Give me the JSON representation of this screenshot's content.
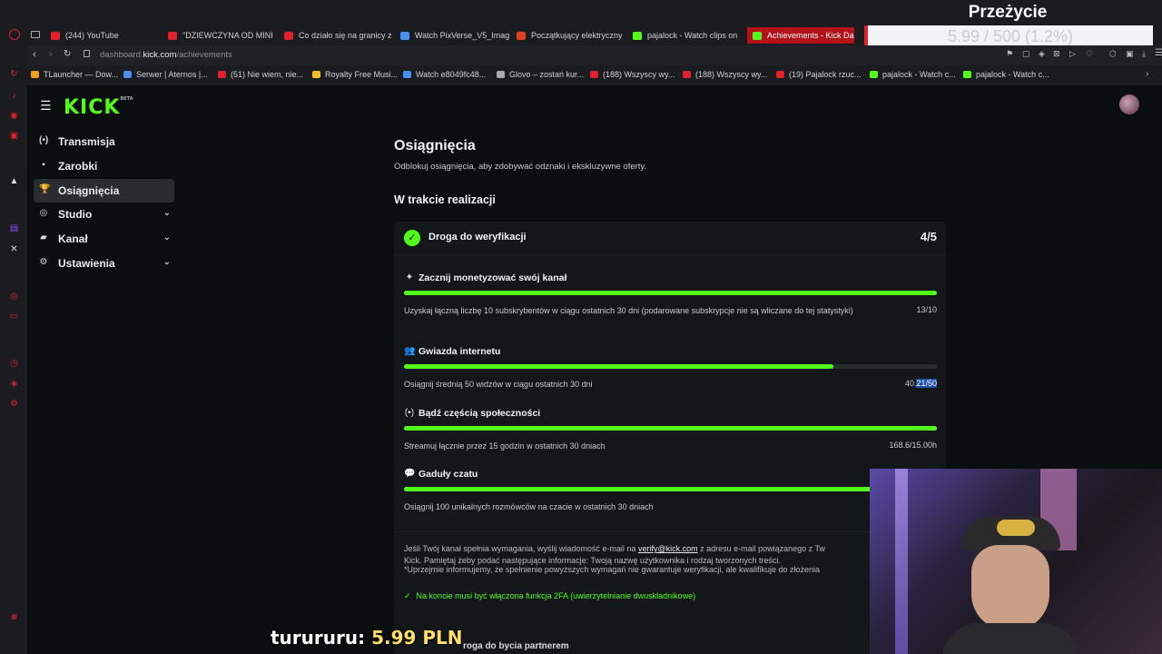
{
  "browser": {
    "tabs": [
      {
        "label": "(244) YouTube",
        "color": "#e0202a",
        "active": false
      },
      {
        "label": "\"DZIEWCZYNA OD MINI",
        "color": "#e0202a",
        "active": false
      },
      {
        "label": "Co działo się na granicy z",
        "color": "#e0202a",
        "active": false
      },
      {
        "label": "Watch PixVerse_V5_Imag",
        "color": "#4a8ef0",
        "active": false
      },
      {
        "label": "Początkujący elektryczny",
        "color": "#e04020",
        "active": false
      },
      {
        "label": "pajalock - Watch clips on",
        "color": "#53fc18",
        "active": false
      },
      {
        "label": "Achievements - Kick Das",
        "color": "#53fc18",
        "active": true
      }
    ],
    "url_prefix": "dashboard.",
    "url_domain": "kick.com",
    "url_path": "/achievements",
    "bookmarks": [
      {
        "label": "TLauncher — Dow...",
        "color": "#f0a020"
      },
      {
        "label": "Serwer | Aternos |...",
        "color": "#4a8ef0"
      },
      {
        "label": "(51) Nie wiem, nie...",
        "color": "#e0202a"
      },
      {
        "label": "Royalty Free Musi...",
        "color": "#f0c020"
      },
      {
        "label": "Watch e8049fc48...",
        "color": "#4a8ef0"
      },
      {
        "label": "Glovo – zostań kur...",
        "color": "#aaaaaa"
      },
      {
        "label": "(188) Wszyscy wy...",
        "color": "#e0202a"
      },
      {
        "label": "(188) Wszyscy wy...",
        "color": "#e0202a"
      },
      {
        "label": "(19) Pajalock rzuc...",
        "color": "#e0202a"
      },
      {
        "label": "pajalock - Watch c...",
        "color": "#53fc18"
      },
      {
        "label": "pajalock - Watch c...",
        "color": "#53fc18"
      }
    ]
  },
  "goal_overlay": {
    "title": "Przeżycie",
    "progress": "5.99 / 500 (1.2%)"
  },
  "sidebar": {
    "logo": "KICK",
    "logo_badge": "BETA",
    "items": [
      {
        "label": "Transmisja",
        "icon": "broadcast-icon",
        "glyph": "(•)",
        "selected": false,
        "expandable": false
      },
      {
        "label": "Zarobki",
        "icon": "wallet-icon",
        "glyph": "▪",
        "selected": false,
        "expandable": false
      },
      {
        "label": "Osiągnięcia",
        "icon": "trophy-icon",
        "glyph": "🏆",
        "selected": true,
        "expandable": false
      },
      {
        "label": "Studio",
        "icon": "studio-icon",
        "glyph": "◎",
        "selected": false,
        "expandable": true
      },
      {
        "label": "Kanał",
        "icon": "channel-icon",
        "glyph": "▰",
        "selected": false,
        "expandable": true
      },
      {
        "label": "Ustawienia",
        "icon": "gear-icon",
        "glyph": "⚙",
        "selected": false,
        "expandable": true
      }
    ]
  },
  "main": {
    "title": "Osiągnięcia",
    "subtitle": "Odblokuj osiągnięcia, aby zdobywać odznaki i ekskluzywne oferty.",
    "section_title": "W trakcie realizacji",
    "card": {
      "title": "Droga do weryfikacji",
      "count": "4/5",
      "tasks": [
        {
          "title": "Zacznij monetyzować swój kanał",
          "icon": "sparkle-icon",
          "glyph": "✦",
          "progress": 1.0,
          "description": "Uzyskaj łączną liczbę 10 subskrybentów w ciągu ostatnich 30 dni (podarowane subskrypcje nie są wliczane do tej statystyki)",
          "value": "13/10"
        },
        {
          "title": "Gwiazda internetu",
          "icon": "users-icon",
          "glyph": "👥",
          "progress": 0.805,
          "description": "Osiągnij średnią 50 widzów w ciągu ostatnich 30 dni",
          "value_prefix": "40.",
          "value_highlight": "21/50"
        },
        {
          "title": "Bądź częścią społeczności",
          "icon": "broadcast-icon",
          "glyph": "(•)",
          "progress": 1.0,
          "description": "Streamuj łącznie przez 15 godzin w ostatnich 30 dniach",
          "value": "168.6/15.00h"
        },
        {
          "title": "Gaduły czatu",
          "icon": "chat-icon",
          "glyph": "💬",
          "progress": 1.0,
          "description": "Osiągnij 100 unikalnych rozmówców na czacie w ostatnich 30 dniach",
          "value": ""
        }
      ],
      "info_line1_a": "Jeśli Twój kanał spełnia wymagania, wyślij wiadomość e-mail na ",
      "info_email": "verify@kick.com",
      "info_line1_b": " z adresu e-mail powiązanego z Tw",
      "info_line1_c": "Kick. Pamiętaj żeby podać następujące informacje: Twoją nazwę użytkownika i rodzaj tworzonych treści.",
      "info_line2": "*Uprzejmie informujemy, że spełnienie powyższych wymagań nie gwarantuje weryfikacji, ale kwalifikuje do złożenia",
      "info_check": "Na koncie musi być włączona funkcja 2FA (uwierzytelnianie dwuskładnikowe)"
    },
    "next_title": "roga do bycia partnerem"
  },
  "donation": {
    "name": "turururu:",
    "amount": "5.99 PLN"
  }
}
